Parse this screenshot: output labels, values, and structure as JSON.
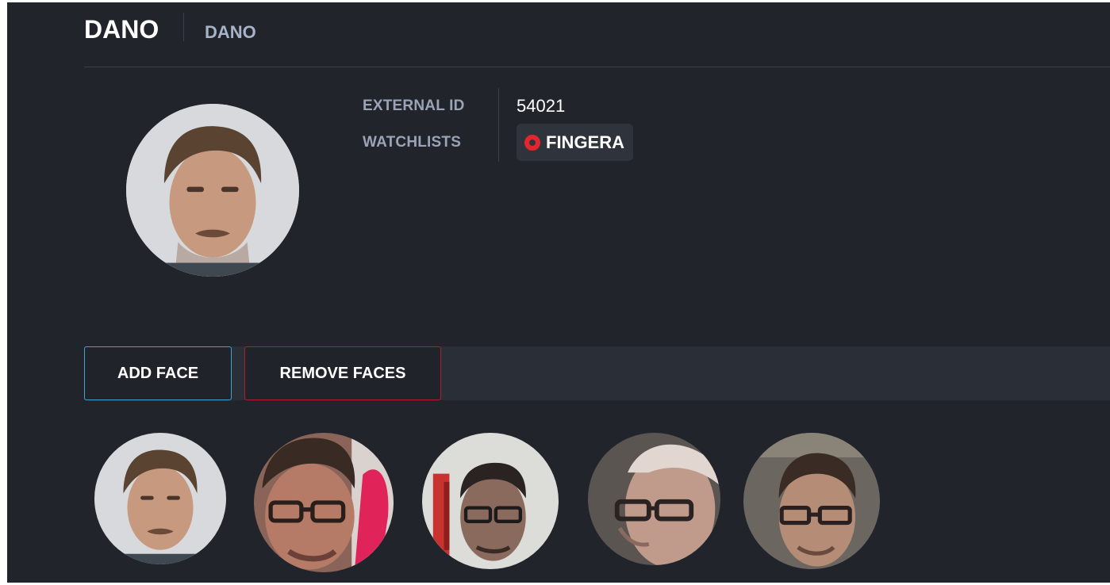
{
  "person": {
    "name": "DANO",
    "secondary_name": "DANO"
  },
  "details": {
    "external_id_label": "EXTERNAL ID",
    "external_id_value": "54021",
    "watchlists_label": "WATCHLISTS",
    "watchlist": {
      "name": "FINGERA",
      "color": "#e3262e"
    }
  },
  "actions": {
    "add_face_label": "ADD FACE",
    "remove_faces_label": "REMOVE FACES"
  }
}
